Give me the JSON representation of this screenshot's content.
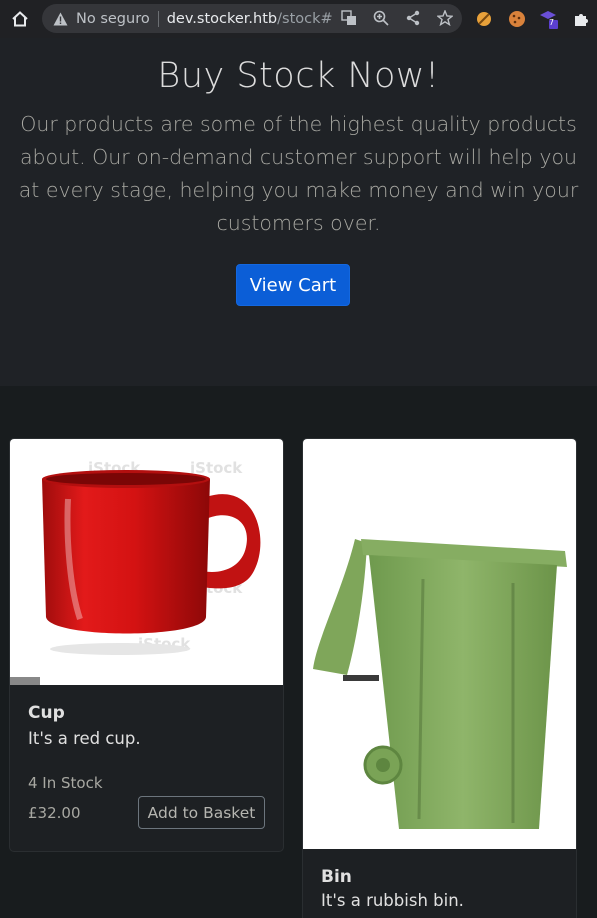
{
  "browser": {
    "insecure_label": "No seguro",
    "host": "dev.stocker.htb",
    "path": "/stock#",
    "extension_badge": "7"
  },
  "hero": {
    "title": "Buy Stock Now!",
    "description": "Our products are some of the highest quality products about. Our on-demand customer support will help you at every stage, helping you make money and win your customers over.",
    "view_cart_label": "View Cart"
  },
  "products": [
    {
      "name": "Cup",
      "description": "It's a red cup.",
      "stock": "4 In Stock",
      "price": "£32.00",
      "button_label": "Add to Basket",
      "watermark": "iStock"
    },
    {
      "name": "Bin",
      "description": "It's a rubbish bin."
    }
  ],
  "colors": {
    "primary": "#0b5ed7",
    "hero_bg": "#1f2226",
    "page_bg": "#181c1e"
  }
}
